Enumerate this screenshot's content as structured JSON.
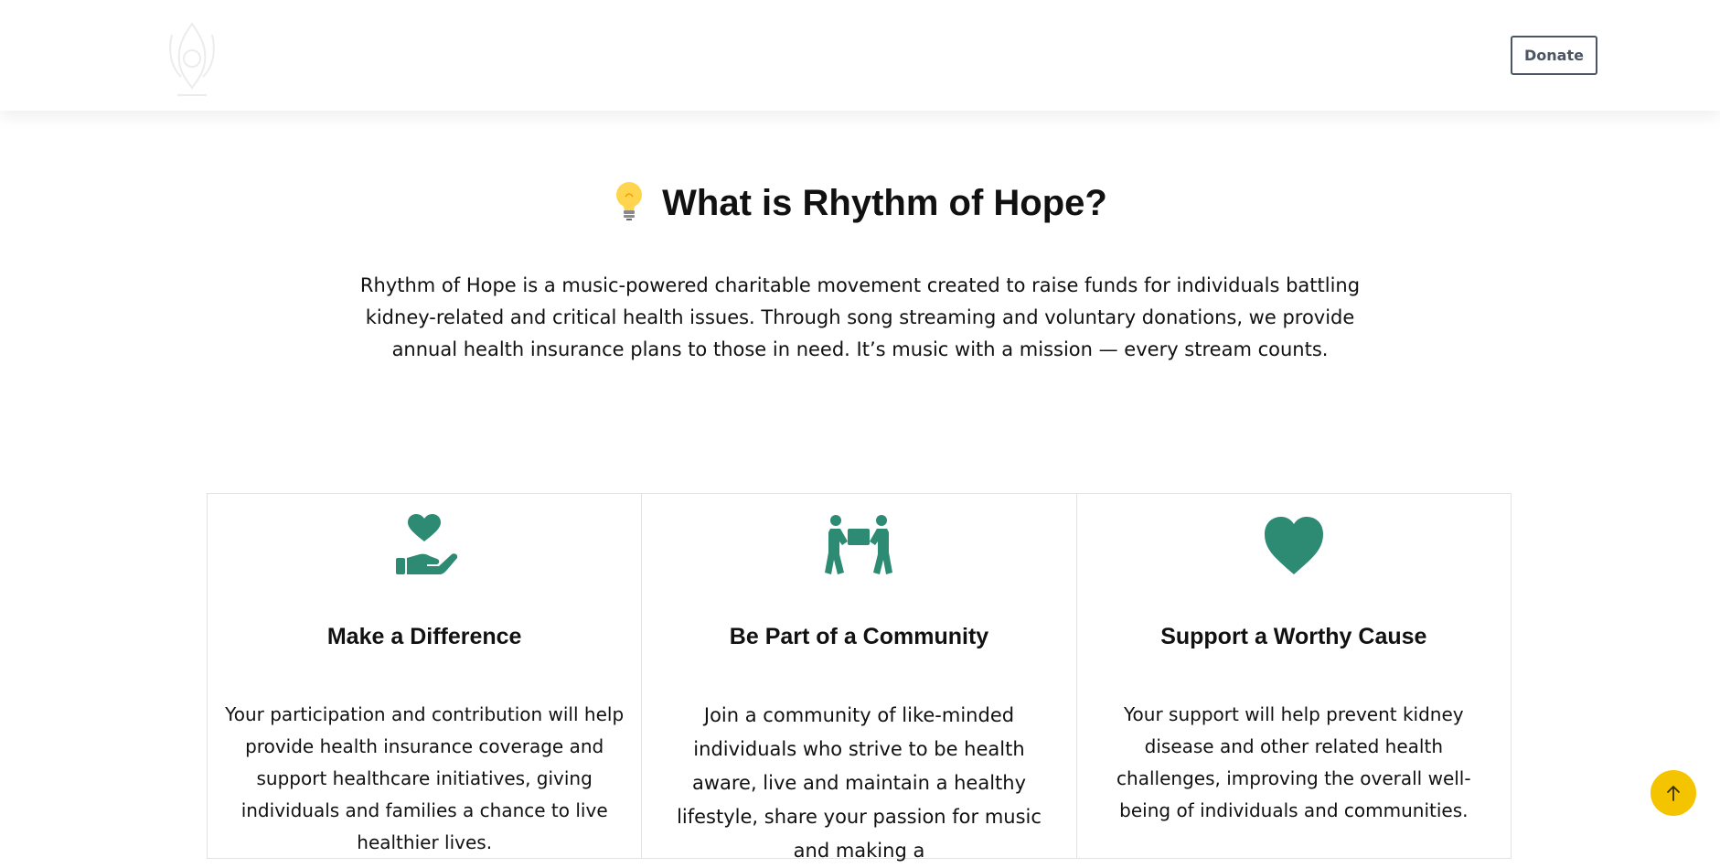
{
  "header": {
    "donate_label": "Donate"
  },
  "intro_section": {
    "title": "What is Rhythm of Hope?",
    "title_icon": "lightbulb-icon",
    "description": "Rhythm of Hope is a music-powered charitable movement created to raise funds for individuals battling kidney-related and critical health issues. Through song streaming and voluntary donations, we provide annual health insurance plans to those in need. It’s music with a mission — every stream counts."
  },
  "cards": [
    {
      "icon": "hand-heart-icon",
      "title": "Make a Difference",
      "text": "Your participation and contribution will help provide health insurance coverage and support healthcare initiatives, giving individuals and families a chance to live healthier lives."
    },
    {
      "icon": "people-carry-icon",
      "title": "Be Part of a Community",
      "text": "Join a community of like-minded individuals who strive to be health aware, live and maintain a healthy lifestyle, share your passion for music and making a"
    },
    {
      "icon": "heart-icon",
      "title": "Support a Worthy Cause",
      "text": "Your support will help prevent kidney disease and other related health challenges, improving the overall well-being of individuals and communities."
    }
  ],
  "colors": {
    "accent": "#2e8b73",
    "scroll_button": "#f5c400"
  }
}
